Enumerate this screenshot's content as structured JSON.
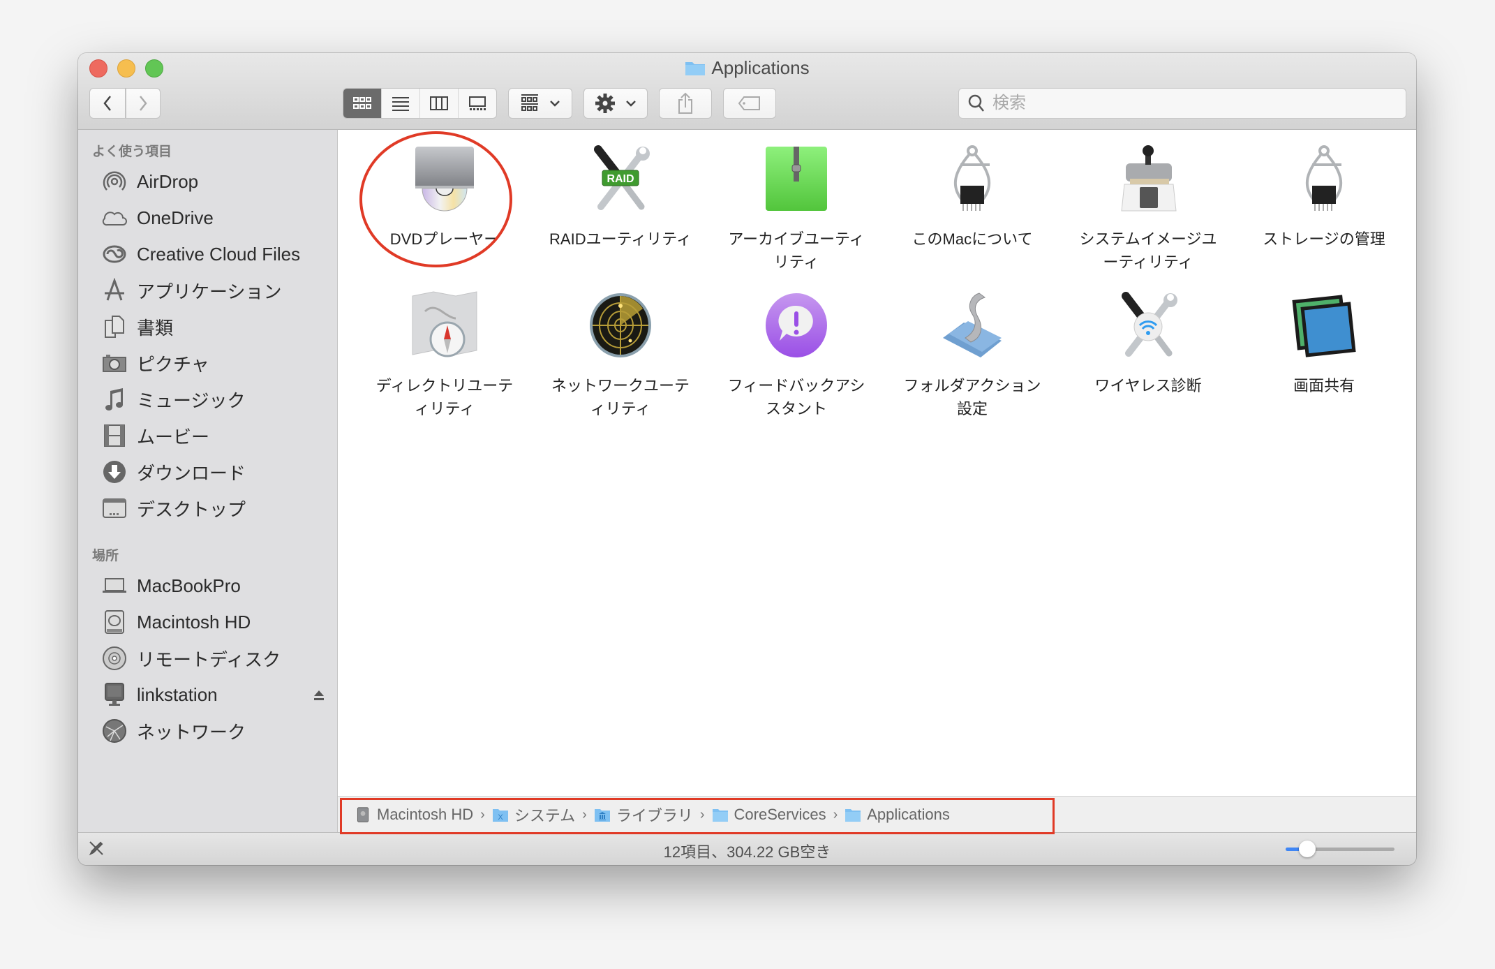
{
  "window": {
    "title": "Applications",
    "colors": {
      "close": "#ee6a5f",
      "minimize": "#f6be4f",
      "zoom": "#62c655",
      "annotation": "#e03a26",
      "accent": "#3f86f5"
    }
  },
  "toolbar": {
    "back_icon": "chevron-left",
    "forward_icon": "chevron-right",
    "view_modes": [
      "icon",
      "list",
      "column",
      "gallery"
    ],
    "active_view": "icon",
    "arrange_icon": "arrange-grid",
    "action_icon": "gear",
    "share_icon": "share",
    "tags_icon": "tag",
    "search_placeholder": "検索"
  },
  "sidebar": {
    "favorites_header": "よく使う項目",
    "favorites": [
      {
        "label": "AirDrop",
        "icon": "airdrop"
      },
      {
        "label": "OneDrive",
        "icon": "cloud"
      },
      {
        "label": "Creative Cloud Files",
        "icon": "creative-cloud"
      },
      {
        "label": "アプリケーション",
        "icon": "applications"
      },
      {
        "label": "書類",
        "icon": "documents"
      },
      {
        "label": "ピクチャ",
        "icon": "camera"
      },
      {
        "label": "ミュージック",
        "icon": "music-note"
      },
      {
        "label": "ムービー",
        "icon": "film"
      },
      {
        "label": "ダウンロード",
        "icon": "download"
      },
      {
        "label": "デスクトップ",
        "icon": "desktop"
      }
    ],
    "locations_header": "場所",
    "locations": [
      {
        "label": "MacBookPro",
        "icon": "laptop"
      },
      {
        "label": "Macintosh HD",
        "icon": "hard-drive"
      },
      {
        "label": "リモートディスク",
        "icon": "disc"
      },
      {
        "label": "linkstation",
        "icon": "server-monitor",
        "ejectable": true
      },
      {
        "label": "ネットワーク",
        "icon": "network-globe"
      }
    ]
  },
  "apps": [
    {
      "label": "DVDプレーヤー",
      "icon": "dvd-player",
      "highlighted": true
    },
    {
      "label": "RAIDユーティリティ",
      "icon": "raid-utility"
    },
    {
      "label": "アーカイブユーティリティ",
      "icon": "archive-utility"
    },
    {
      "label": "このMacについて",
      "icon": "about-this-mac"
    },
    {
      "label": "システムイメージユーティリティ",
      "icon": "system-image-utility"
    },
    {
      "label": "ストレージの管理",
      "icon": "storage-management"
    },
    {
      "label": "ディレクトリユーティリティ",
      "icon": "directory-utility"
    },
    {
      "label": "ネットワークユーティリティ",
      "icon": "network-utility"
    },
    {
      "label": "フィードバックアシスタント",
      "icon": "feedback-assistant"
    },
    {
      "label": "フォルダアクション設定",
      "icon": "folder-actions-setup"
    },
    {
      "label": "ワイヤレス診断",
      "icon": "wireless-diagnostics"
    },
    {
      "label": "画面共有",
      "icon": "screen-sharing"
    }
  ],
  "pathbar": {
    "segments": [
      {
        "label": "Macintosh HD",
        "icon": "hard-drive"
      },
      {
        "label": "システム",
        "icon": "system-folder"
      },
      {
        "label": "ライブラリ",
        "icon": "library-folder"
      },
      {
        "label": "CoreServices",
        "icon": "folder"
      },
      {
        "label": "Applications",
        "icon": "folder"
      }
    ],
    "highlighted": true
  },
  "status": {
    "text": "12項目、304.22 GB空き",
    "icon_size_fraction": 0.2
  }
}
